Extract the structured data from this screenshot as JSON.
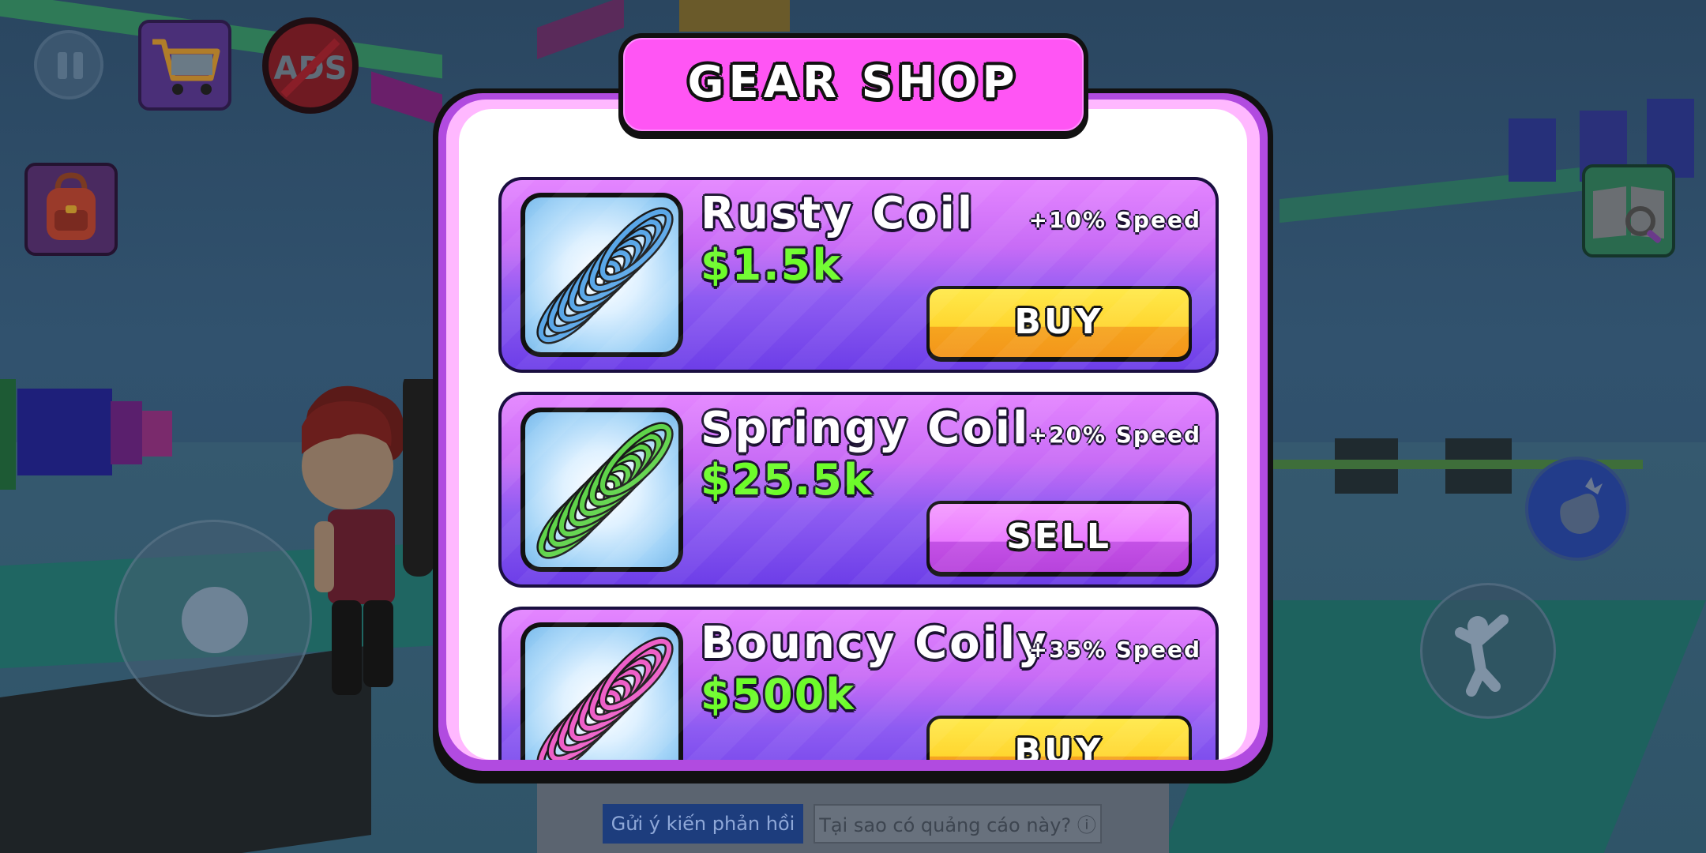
{
  "shop": {
    "title": "GEAR SHOP",
    "items": [
      {
        "name": "Rusty Coil",
        "price": "$1.5k",
        "stat": "+10% Speed",
        "action": "BUY",
        "action_type": "buy",
        "coil_color": "#5aa7e8",
        "icon": "blue-coil-icon"
      },
      {
        "name": "Springy Coil",
        "price": "$25.5k",
        "stat": "+20% Speed",
        "action": "SELL",
        "action_type": "sell",
        "coil_color": "#5fd34a",
        "icon": "green-coil-icon"
      },
      {
        "name": "Bouncy Coily",
        "price": "$500k",
        "stat": "+35% Speed",
        "action": "BUY",
        "action_type": "buy",
        "coil_color": "#ee5fc8",
        "icon": "pink-coil-icon"
      }
    ]
  },
  "hud": {
    "pause_icon": "pause-icon",
    "cart_icon": "shopping-cart-icon",
    "noads_label": "ADS",
    "backpack_icon": "backpack-icon",
    "book_icon": "book-search-icon",
    "jump_icon": "jump-icon",
    "action_icon": "hand-icon"
  },
  "ad_banner": {
    "feedback_button": "Gửi ý kiến phản hồi",
    "why_ad_button": "Tại sao có quảng cáo này? ⓘ"
  },
  "colors": {
    "title_bg": "#ff55f4",
    "price": "#6dfc2a",
    "buy": "#ffd630",
    "sell": "#ea7cff"
  }
}
